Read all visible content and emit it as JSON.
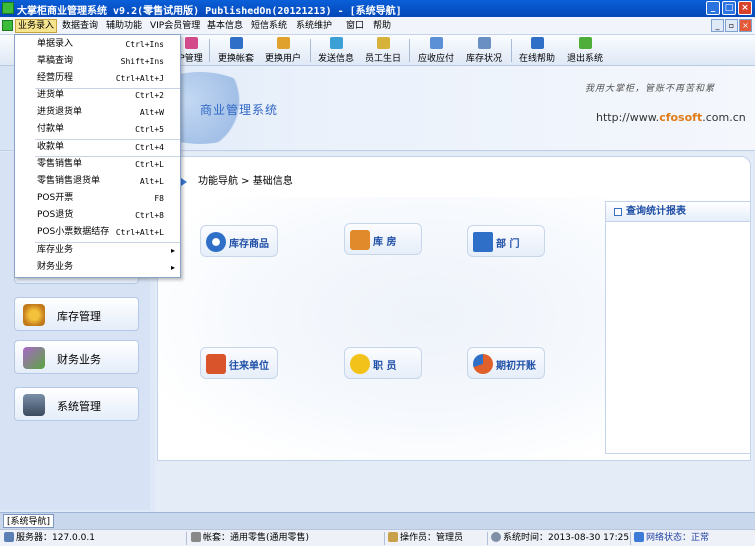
{
  "window": {
    "title": "大掌柜商业管理系统 v9.2(零售试用版) PublishedOn(20121213)  - [系统导航]",
    "buttons": [
      "_",
      "□",
      "×"
    ]
  },
  "menubar": {
    "items": [
      "业务录入",
      "数据查询",
      "辅助功能",
      "VIP会员管理",
      "基本信息",
      "短信系统",
      "系统维护",
      "窗口",
      "帮助"
    ],
    "active_index": 0
  },
  "toolbar": {
    "items": [
      {
        "label": "P管理",
        "icon": "vip-icon",
        "color": "#d24a8a"
      },
      {
        "label": "更换帐套",
        "icon": "switch-account-icon",
        "color": "#2f6fc7"
      },
      {
        "label": "更换用户",
        "icon": "switch-user-icon",
        "color": "#e0a22c"
      },
      {
        "label": "发送信息",
        "icon": "send-message-icon",
        "color": "#3aa0d6"
      },
      {
        "label": "员工生日",
        "icon": "birthday-icon",
        "color": "#d7b23a"
      },
      {
        "label": "应收应付",
        "icon": "receivable-icon",
        "color": "#5b8fd6"
      },
      {
        "label": "库存状况",
        "icon": "inventory-status-icon",
        "color": "#6a8fc2"
      },
      {
        "label": "在线帮助",
        "icon": "online-help-icon",
        "color": "#2f6fc7"
      },
      {
        "label": "退出系统",
        "icon": "exit-icon",
        "color": "#4fae3a"
      }
    ]
  },
  "banner": {
    "brand": "商业管理系统",
    "slogan": "我用大掌柜，管账不再苦和累",
    "url_prefix": "http://www.",
    "url_brand": "cfosoft",
    "url_suffix": ".com.cn"
  },
  "dropdown": {
    "items": [
      {
        "label": "单据录入",
        "shortcut": "Ctrl+Ins"
      },
      {
        "label": "草稿查询",
        "shortcut": "Shift+Ins"
      },
      {
        "label": "经营历程",
        "shortcut": "Ctrl+Alt+J"
      },
      {
        "label": "进货单",
        "shortcut": "Ctrl+2"
      },
      {
        "label": "进货退货单",
        "shortcut": "Alt+W"
      },
      {
        "label": "付款单",
        "shortcut": "Ctrl+5"
      },
      {
        "label": "收款单",
        "shortcut": "Ctrl+4"
      },
      {
        "label": "零售销售单",
        "shortcut": "Ctrl+L"
      },
      {
        "label": "零售销售退货单",
        "shortcut": "Alt+L"
      },
      {
        "label": "POS开票",
        "shortcut": "F8"
      },
      {
        "label": "POS退货",
        "shortcut": "Ctrl+8"
      },
      {
        "label": "POS小票数据结存",
        "shortcut": "Ctrl+Alt+L"
      },
      {
        "label": "库存业务",
        "shortcut": "▸"
      },
      {
        "label": "财务业务",
        "shortcut": "▸"
      }
    ]
  },
  "leftnav": {
    "items": [
      {
        "label": "库存管理",
        "icon": "inventory-management-icon"
      },
      {
        "label": "财务业务",
        "icon": "finance-icon"
      },
      {
        "label": "系统管理",
        "icon": "system-management-icon"
      }
    ]
  },
  "main": {
    "breadcrumb": "功能导航 > 基础信息",
    "functions": [
      {
        "label": "库存商品",
        "icon": "gear-icon",
        "color": "#2f6fc7"
      },
      {
        "label": "库 房",
        "icon": "house-icon",
        "color": "#e08a2c"
      },
      {
        "label": "部 门",
        "icon": "computer-icon",
        "color": "#2f6fc7"
      },
      {
        "label": "往来单位",
        "icon": "folder-icon",
        "color": "#d9542a"
      },
      {
        "label": "职 员",
        "icon": "smiley-icon",
        "color": "#f2c21b"
      },
      {
        "label": "期初开账",
        "icon": "pie-chart-icon",
        "color": "#e0602c"
      }
    ],
    "query_title": "查询统计报表"
  },
  "tabbar": {
    "tab": "[系统导航]"
  },
  "statusbar": {
    "server": "服务器：127.0.0.1",
    "account": "帐套：通用零售(通用零售)",
    "operator": "操作员：管理员",
    "time": "系统时间：2013-08-30 17:25",
    "network": "网络状态：正常"
  }
}
